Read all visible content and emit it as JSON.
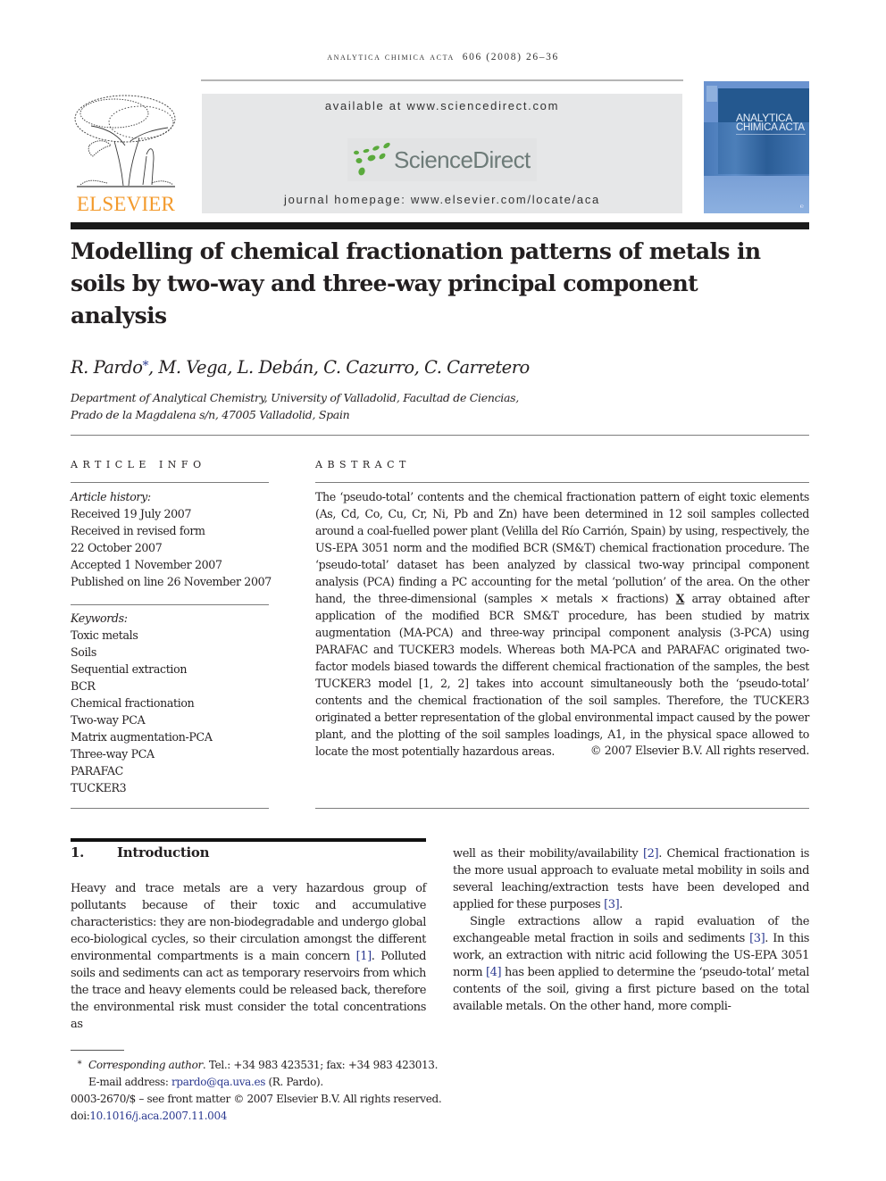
{
  "header": {
    "journal_name": "analytica chimica acta",
    "volume_pages": "606 (2008) 26–36",
    "publisher_logo_text": "ELSEVIER",
    "available_at": "available at www.sciencedirect.com",
    "sciencedirect_logo_text": "ScienceDirect",
    "journal_homepage": "journal homepage: www.elsevier.com/locate/aca",
    "cover_title_line1": "ANALYTICA",
    "cover_title_line2": "CHIMICA ACTA",
    "colors": {
      "elsevier_orange": "#f39a2c",
      "sciencedirect_green": "#5aaa3c",
      "sciencedirect_gray": "#6d7b78",
      "cover_blue": "#24588f",
      "link_blue": "#2b3990"
    }
  },
  "article": {
    "title": "Modelling of chemical fractionation patterns of metals in soils by two-way and three-way principal component analysis",
    "title_lines": [
      "Modelling of chemical fractionation patterns of metals in",
      "soils by two-way and three-way principal component",
      "analysis"
    ],
    "authors": {
      "first": "R. Pardo",
      "corresponding_mark": "*",
      "rest": ", M. Vega, L. Debán, C. Cazurro, C. Carretero"
    },
    "affiliation_lines": [
      "Department of Analytical Chemistry, University of Valladolid, Facultad de Ciencias,",
      "Prado de la Magdalena s/n, 47005 Valladolid, Spain"
    ]
  },
  "article_info": {
    "heading": "ARTICLE INFO",
    "history_label": "Article history:",
    "history": [
      "Received 19 July 2007",
      "Received in revised form",
      "22 October 2007",
      "Accepted 1 November 2007",
      "Published on line 26 November 2007"
    ],
    "keywords_label": "Keywords:",
    "keywords": [
      "Toxic metals",
      "Soils",
      "Sequential extraction",
      "BCR",
      "Chemical fractionation",
      "Two-way PCA",
      "Matrix augmentation-PCA",
      "Three-way PCA",
      "PARAFAC",
      "TUCKER3"
    ]
  },
  "abstract": {
    "heading": "ABSTRACT",
    "text_before_x": "The ‘pseudo-total’ contents and the chemical fractionation pattern of eight toxic elements (As, Cd, Co, Cu, Cr, Ni, Pb and Zn) have been determined in 12 soil samples collected around a coal-fuelled power plant (Velilla del Río Carrión, Spain) by using, respectively, the US-EPA 3051 norm and the modified BCR (SM&T) chemical fractionation procedure. The ‘pseudo-total’ dataset has been analyzed by classical two-way principal component analysis (PCA) finding a PC accounting for the metal ‘pollution’ of the area. On the other hand, the three-dimensional (samples × metals × fractions) ",
    "x_symbol": "X",
    "text_after_x": " array obtained after application of the modified BCR SM&T procedure, has been studied by matrix augmentation (MA-PCA) and three-way principal component analysis (3-PCA) using PARAFAC and TUCKER3 models. Whereas both MA-PCA and PARAFAC originated two-factor models biased towards the different chemical fractionation of the samples, the best TUCKER3 model [1, 2, 2] takes into account simultaneously both the ‘pseudo-total’ contents and the chemical fractionation of the soil samples. Therefore, the TUCKER3 originated a better representation of the global environmental impact caused by the power plant, and the plotting of the soil samples loadings, A1, in the physical space allowed to locate the most potentially hazardous areas.",
    "copyright": "© 2007 Elsevier B.V. All rights reserved."
  },
  "introduction": {
    "number": "1.",
    "heading": "Introduction",
    "left_p1_a": "Heavy and trace metals are a very hazardous group of pollutants because of their toxic and accumulative characteristics: they are non-biodegradable and undergo global eco-biological cycles, so their circulation amongst the different environmental compartments is a main concern ",
    "ref1": "[1]",
    "left_p1_b": ". Polluted soils and sediments can act as temporary reservoirs from which the trace and heavy elements could be released back, therefore the environmental risk must consider the total concentrations as",
    "right_p1_a": "well as their mobility/availability ",
    "ref2": "[2]",
    "right_p1_b": ". Chemical fractionation is the more usual approach to evaluate metal mobility in soils and several leaching/extraction tests have been developed and applied for these purposes ",
    "ref3": "[3]",
    "right_p1_c": ".",
    "right_p2_a": "Single extractions allow a rapid evaluation of the exchangeable metal fraction in soils and sediments ",
    "ref3b": "[3]",
    "right_p2_b": ". In this work, an extraction with nitric acid following the US-EPA 3051 norm ",
    "ref4": "[4]",
    "right_p2_c": " has been applied to determine the ‘pseudo-total’ metal contents of the soil, giving a first picture based on the total available metals. On the other hand, more compli-"
  },
  "footnotes": {
    "mark": "*",
    "corresponding_label": "Corresponding author",
    "contact": ". Tel.: +34 983 423531; fax: +34 983 423013.",
    "email_label": "E-mail address: ",
    "email": "rpardo@qa.uva.es",
    "email_suffix": " (R. Pardo).",
    "issn_line": "0003-2670/$ – see front matter © 2007 Elsevier B.V. All rights reserved.",
    "doi_label": "doi:",
    "doi": "10.1016/j.aca.2007.11.004"
  }
}
